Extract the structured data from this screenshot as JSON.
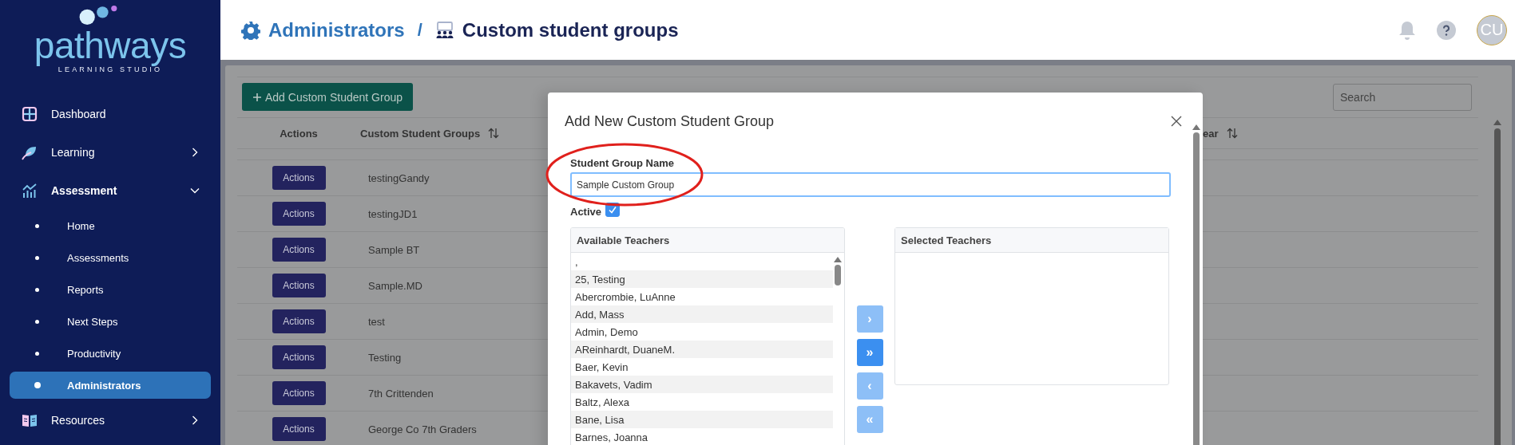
{
  "sidebar": {
    "logo": {
      "name": "pathways",
      "tagline": "LEARNING STUDIO"
    },
    "items": [
      {
        "label": "Dashboard",
        "kind": "link"
      },
      {
        "label": "Learning",
        "kind": "group",
        "expanded": false
      },
      {
        "label": "Assessment",
        "kind": "group",
        "expanded": true,
        "children": [
          {
            "label": "Home",
            "selected": false
          },
          {
            "label": "Assessments",
            "selected": false
          },
          {
            "label": "Reports",
            "selected": false
          },
          {
            "label": "Next Steps",
            "selected": false
          },
          {
            "label": "Productivity",
            "selected": false
          },
          {
            "label": "Administrators",
            "selected": true
          }
        ]
      },
      {
        "label": "Resources",
        "kind": "group",
        "expanded": false
      }
    ]
  },
  "header": {
    "breadcrumb": [
      {
        "label": "Administrators",
        "kind": "link"
      },
      {
        "label": "Custom student groups",
        "kind": "current"
      }
    ],
    "separator": "/",
    "avatar": "CU"
  },
  "toolbar": {
    "add_button": "Add Custom Student Group",
    "search": {
      "placeholder": "Search"
    }
  },
  "table": {
    "columns": [
      {
        "label": "Actions",
        "sortable": false
      },
      {
        "label": "Custom Student Groups",
        "sortable": true
      },
      {
        "label": "ear",
        "sortable": true
      }
    ],
    "rows": [
      {
        "action": "Actions",
        "name": "testingGandy"
      },
      {
        "action": "Actions",
        "name": "testingJD1"
      },
      {
        "action": "Actions",
        "name": "Sample BT"
      },
      {
        "action": "Actions",
        "name": "Sample.MD"
      },
      {
        "action": "Actions",
        "name": "test"
      },
      {
        "action": "Actions",
        "name": "Testing"
      },
      {
        "action": "Actions",
        "name": "7th Crittenden"
      },
      {
        "action": "Actions",
        "name": "George Co 7th Graders"
      }
    ]
  },
  "modal": {
    "title": "Add New Custom Student Group",
    "name_field": {
      "label": "Student Group Name",
      "value": "Sample Custom Group"
    },
    "active": {
      "label": "Active",
      "checked": true
    },
    "available": {
      "title": "Available Teachers",
      "items": [
        ",",
        "25, Testing",
        "Abercrombie, LuAnne",
        "Add, Mass",
        "Admin, Demo",
        "AReinhardt, DuaneM.",
        "Baer, Kevin",
        "Bakavets, Vadim",
        "Baltz, Alexa",
        "Bane, Lisa",
        "Barnes, Joanna"
      ]
    },
    "transfer_buttons": [
      {
        "symbol": "›",
        "disabled": true
      },
      {
        "symbol": "»",
        "disabled": false
      },
      {
        "symbol": "‹",
        "disabled": true
      },
      {
        "symbol": "«",
        "disabled": true
      }
    ],
    "selected": {
      "title": "Selected Teachers"
    }
  }
}
